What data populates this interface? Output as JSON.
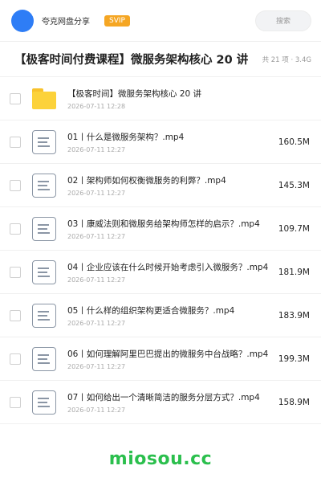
{
  "header": {
    "brand": "夸克网盘分享",
    "badge": "SVIP",
    "search_placeholder": "搜索"
  },
  "share": {
    "title": "【极客时间付费课程】微服务架构核心 20 讲",
    "meta": "共 21 项 · 3.4G"
  },
  "items": [
    {
      "type": "folder",
      "name": "【极客时间】微服务架构核心 20 讲",
      "date": "2026-07-11 12:28",
      "size": ""
    },
    {
      "type": "file",
      "name": "01丨什么是微服务架构？.mp4",
      "date": "2026-07-11 12:27",
      "size": "160.5M"
    },
    {
      "type": "file",
      "name": "02丨架构师如何权衡微服务的利弊？.mp4",
      "date": "2026-07-11 12:27",
      "size": "145.3M"
    },
    {
      "type": "file",
      "name": "03丨康威法则和微服务给架构师怎样的启示？.mp4",
      "date": "2026-07-11 12:27",
      "size": "109.7M"
    },
    {
      "type": "file",
      "name": "04丨企业应该在什么时候开始考虑引入微服务？.mp4",
      "date": "2026-07-11 12:27",
      "size": "181.9M"
    },
    {
      "type": "file",
      "name": "05丨什么样的组织架构更适合微服务？.mp4",
      "date": "2026-07-11 12:27",
      "size": "183.9M"
    },
    {
      "type": "file",
      "name": "06丨如何理解阿里巴巴提出的微服务中台战略？.mp4",
      "date": "2026-07-11 12:27",
      "size": "199.3M"
    },
    {
      "type": "file",
      "name": "07丨如何给出一个清晰简洁的服务分层方式？.mp4",
      "date": "2026-07-11 12:27",
      "size": "158.9M"
    }
  ],
  "footer": {
    "watermark": "miosou.cc"
  },
  "colors": {
    "avatar": "#2e7df6",
    "badge": "#f5a623",
    "folder": "#fcd23a",
    "watermark": "#2bbf4d"
  }
}
